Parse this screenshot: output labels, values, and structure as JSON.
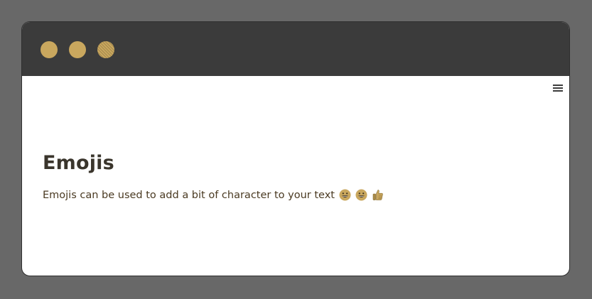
{
  "colors": {
    "accent": "#c9a75e",
    "titlebar": "#3b3b3b",
    "backdrop": "#686868"
  },
  "window": {
    "controls": [
      {
        "name": "close-button",
        "icon": "circle"
      },
      {
        "name": "minimize-button",
        "icon": "circle"
      },
      {
        "name": "maximize-button",
        "icon": "circle"
      }
    ],
    "menu_icon": "hamburger-menu-icon"
  },
  "content": {
    "heading": "Emojis",
    "text": "Emojis can be used to add a bit of character to your text",
    "emojis": [
      "grinning-face-emoji",
      "grinning-face-emoji",
      "thumbs-up-emoji"
    ]
  }
}
